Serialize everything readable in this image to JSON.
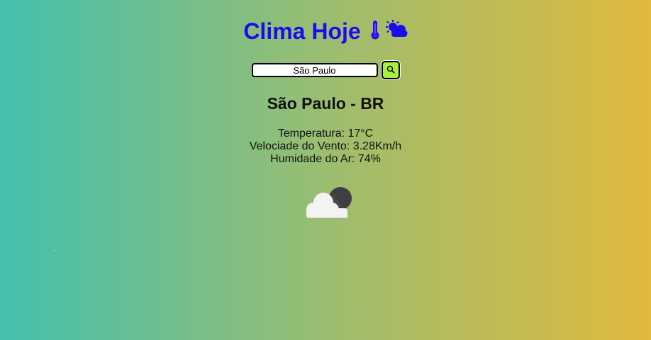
{
  "header": {
    "title": "Clima Hoje",
    "icons": [
      "thermometer-icon",
      "partly-cloudy-icon"
    ],
    "title_color": "#1b0cf0"
  },
  "search": {
    "value": "São Paulo",
    "button_icon": "search-icon",
    "button_color": "#a8f040"
  },
  "weather": {
    "city": "São Paulo - BR",
    "temperature": "Temperatura: 17°C",
    "wind": "Velociade do Vento: 3.28Km/h",
    "humidity": "Humidade do Ar: 74%",
    "icon": "cloudy-night-icon"
  },
  "theme": {
    "gradient_start": "#43c0ae",
    "gradient_end": "#e0b93e"
  }
}
